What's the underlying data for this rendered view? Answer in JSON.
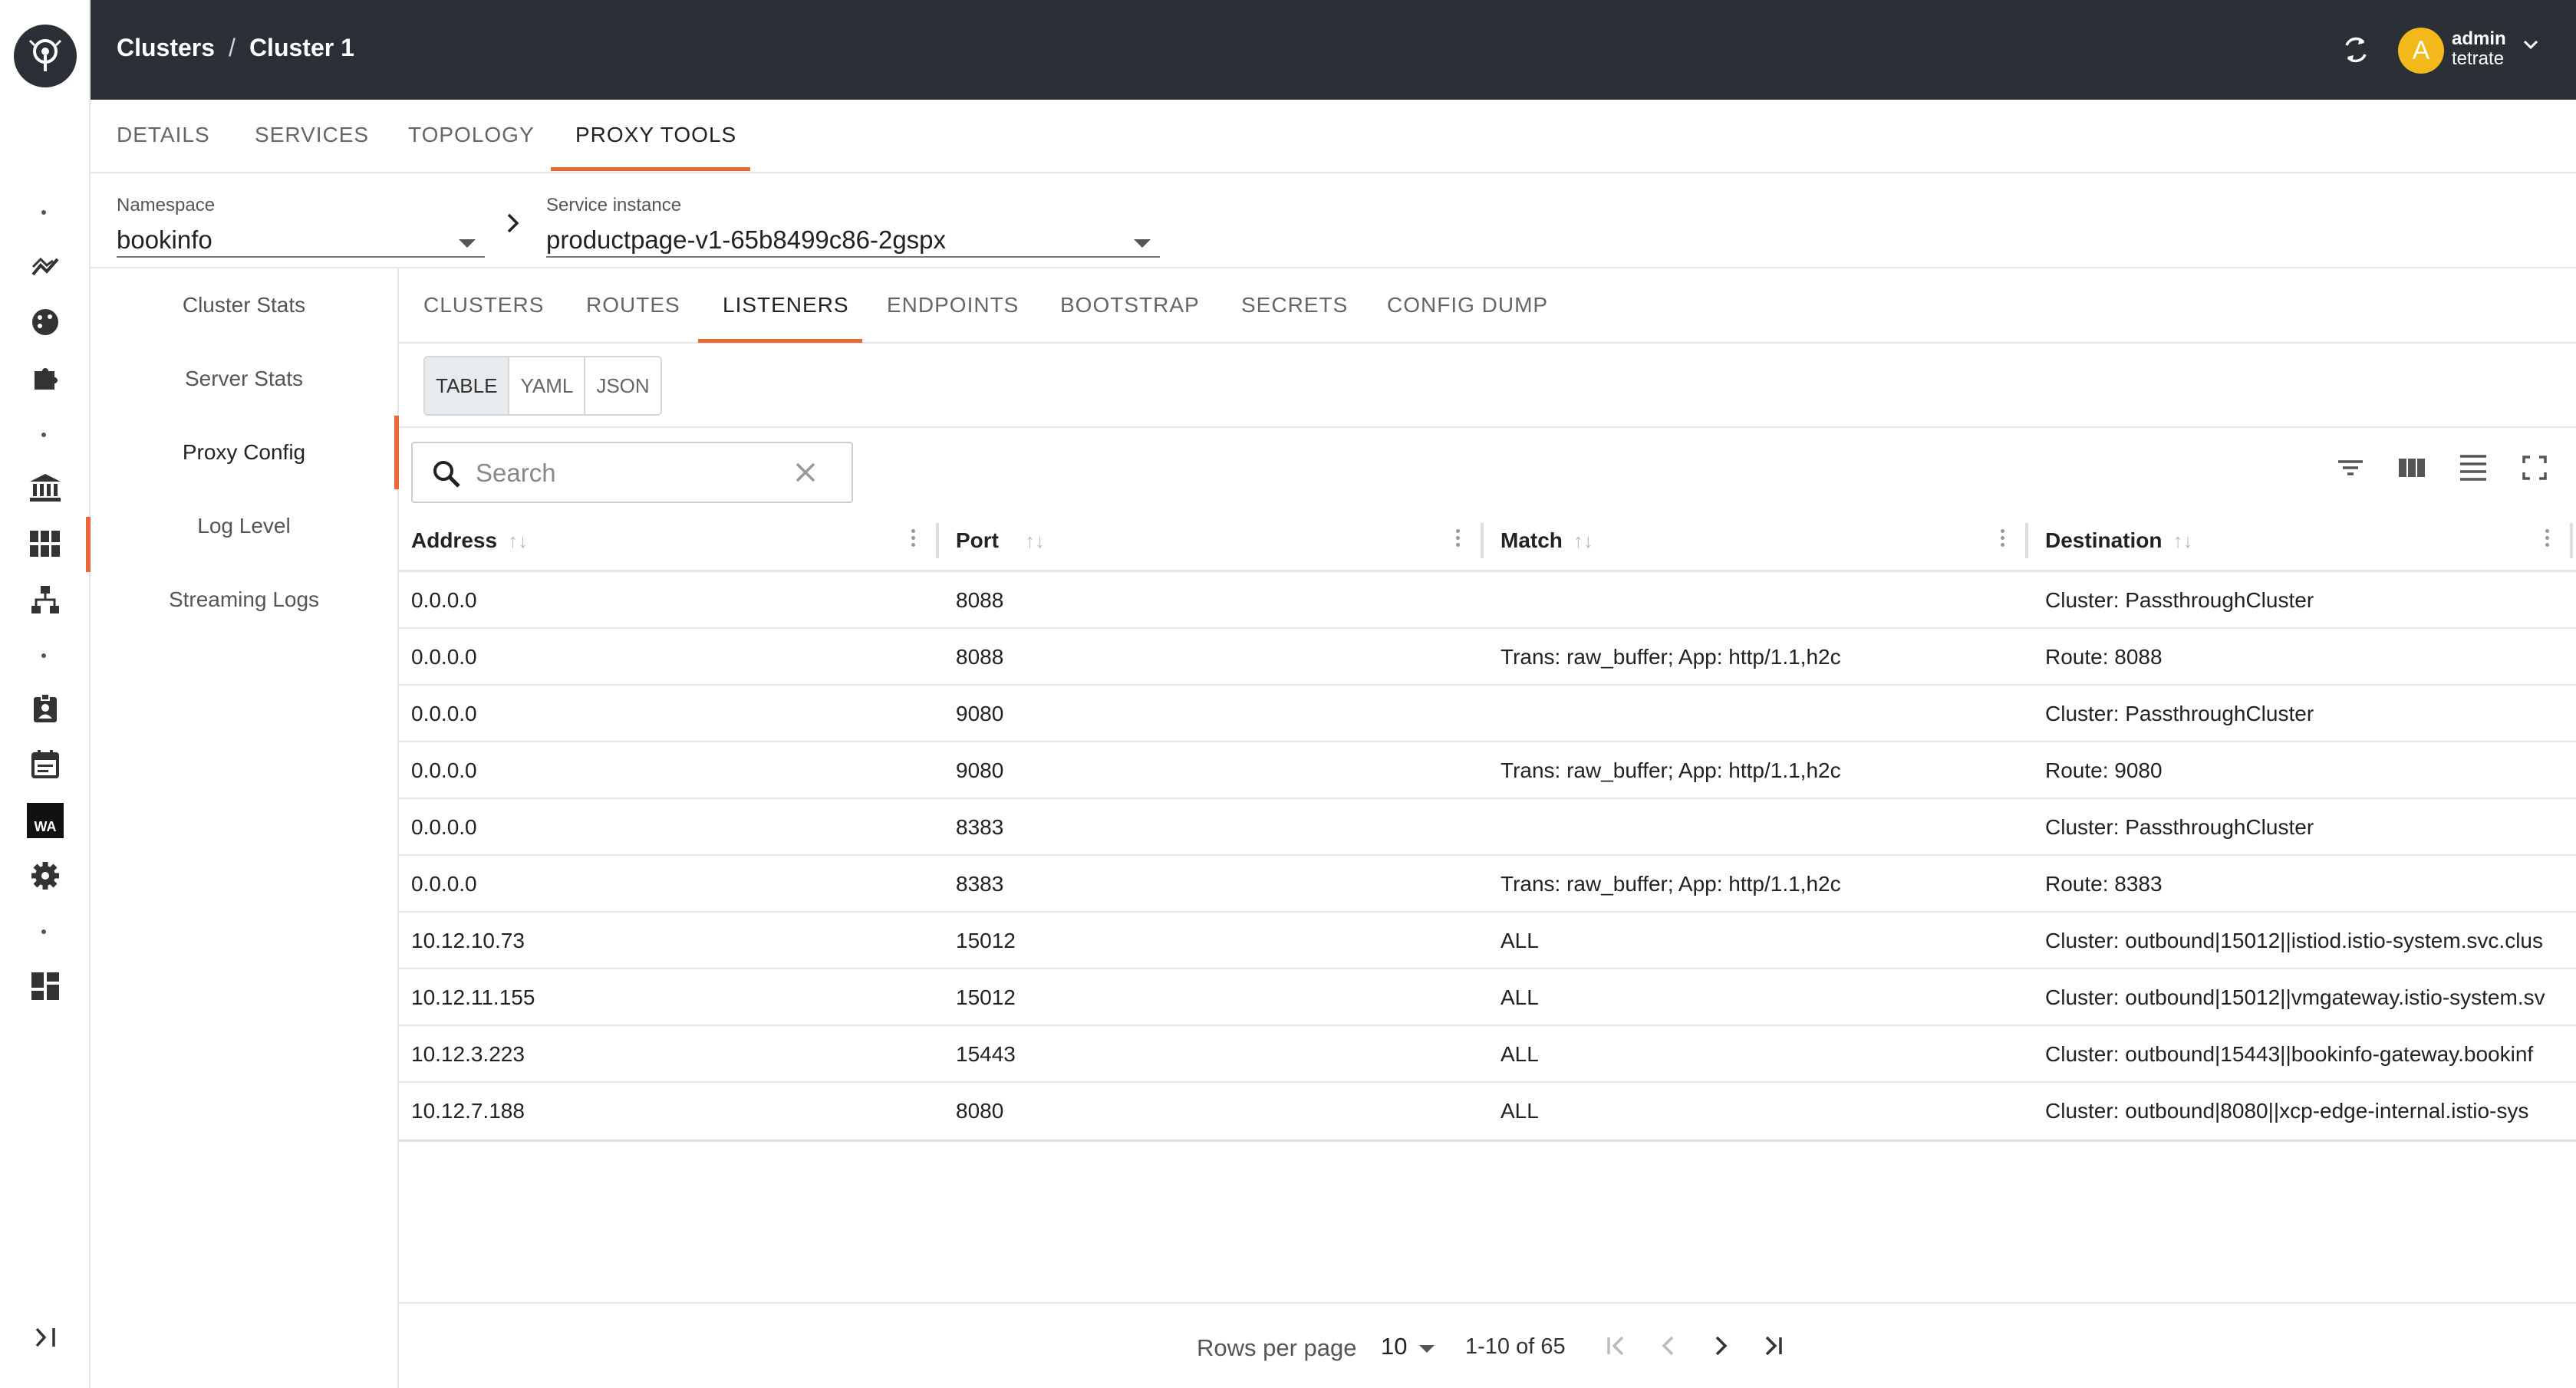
{
  "header": {
    "breadcrumb": [
      "Clusters",
      "Cluster 1"
    ],
    "breadcrumb_sep": "/",
    "avatar_letter": "A",
    "user_name": "admin",
    "user_org": "tetrate"
  },
  "rail": {
    "icons": [
      "logo-icon",
      "trending-icon",
      "palette-icon",
      "puzzle-icon",
      "bank-icon",
      "grid-icon",
      "sitemap-icon",
      "badge-icon",
      "calendar-icon",
      "wa-icon",
      "gear-icon",
      "dashboard-icon"
    ],
    "wa_label": "WA"
  },
  "main_tabs": [
    "DETAILS",
    "SERVICES",
    "TOPOLOGY",
    "PROXY TOOLS"
  ],
  "active_main_tab": "PROXY TOOLS",
  "selectors": {
    "namespace_label": "Namespace",
    "namespace_value": "bookinfo",
    "instance_label": "Service instance",
    "instance_value": "productpage-v1-65b8499c86-2gspx"
  },
  "subnav": [
    "Cluster Stats",
    "Server Stats",
    "Proxy Config",
    "Log Level",
    "Streaming Logs"
  ],
  "active_subnav": "Proxy Config",
  "content_tabs": [
    "CLUSTERS",
    "ROUTES",
    "LISTENERS",
    "ENDPOINTS",
    "BOOTSTRAP",
    "SECRETS",
    "CONFIG DUMP"
  ],
  "active_content_tab": "LISTENERS",
  "formats": [
    "TABLE",
    "YAML",
    "JSON"
  ],
  "active_format": "TABLE",
  "search": {
    "placeholder": "Search"
  },
  "table": {
    "columns": [
      "Address",
      "Port",
      "Match",
      "Destination"
    ],
    "sort_glyph": "↑↓",
    "rows": [
      [
        "0.0.0.0",
        "8088",
        "",
        "Cluster: PassthroughCluster"
      ],
      [
        "0.0.0.0",
        "8088",
        "Trans: raw_buffer; App: http/1.1,h2c",
        "Route: 8088"
      ],
      [
        "0.0.0.0",
        "9080",
        "",
        "Cluster: PassthroughCluster"
      ],
      [
        "0.0.0.0",
        "9080",
        "Trans: raw_buffer; App: http/1.1,h2c",
        "Route: 9080"
      ],
      [
        "0.0.0.0",
        "8383",
        "",
        "Cluster: PassthroughCluster"
      ],
      [
        "0.0.0.0",
        "8383",
        "Trans: raw_buffer; App: http/1.1,h2c",
        "Route: 8383"
      ],
      [
        "10.12.10.73",
        "15012",
        "ALL",
        "Cluster: outbound|15012||istiod.istio-system.svc.clus"
      ],
      [
        "10.12.11.155",
        "15012",
        "ALL",
        "Cluster: outbound|15012||vmgateway.istio-system.sv"
      ],
      [
        "10.12.3.223",
        "15443",
        "ALL",
        "Cluster: outbound|15443||bookinfo-gateway.bookinf"
      ],
      [
        "10.12.7.188",
        "8080",
        "ALL",
        "Cluster: outbound|8080||xcp-edge-internal.istio-sys"
      ]
    ]
  },
  "pagination": {
    "rows_per_page_label": "Rows per page",
    "rows_per_page": "10",
    "range": "1-10 of 65"
  }
}
